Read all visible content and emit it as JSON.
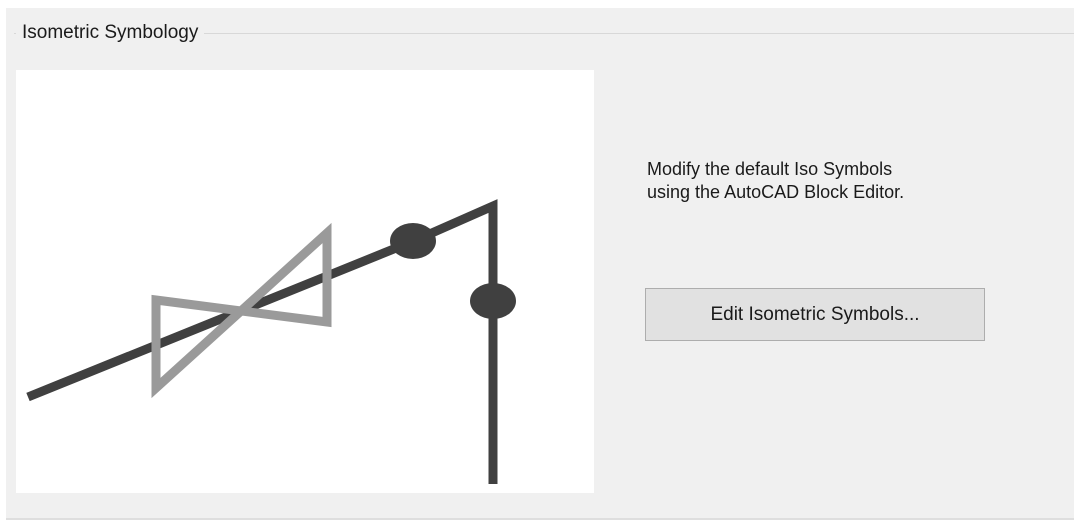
{
  "group": {
    "title": "Isometric Symbology"
  },
  "preview": {
    "icon": "isometric-valve-symbol",
    "pipe_color": "#404040",
    "valve_color": "#9a9a9a"
  },
  "description": {
    "line1": "Modify the default Iso Symbols",
    "line2": "using the AutoCAD Block Editor."
  },
  "actions": {
    "edit_label": "Edit Isometric Symbols..."
  }
}
